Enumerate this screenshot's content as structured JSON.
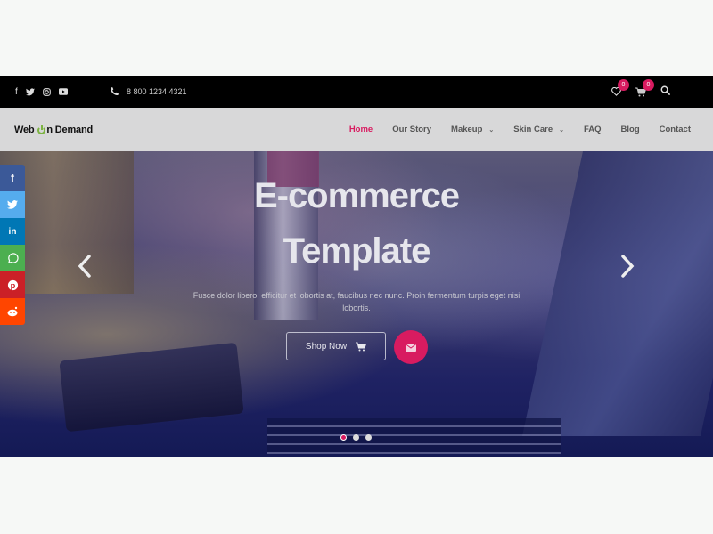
{
  "topbar": {
    "social_icons": [
      "facebook-icon",
      "twitter-icon",
      "instagram-icon",
      "youtube-icon"
    ],
    "phone": "8 800 1234 4321",
    "wishlist_count": "0",
    "cart_count": "0"
  },
  "navbar": {
    "logo_part1": "Web ",
    "logo_part2": "n Demand",
    "items": [
      {
        "label": "Home",
        "active": true
      },
      {
        "label": "Our Story"
      },
      {
        "label": "Makeup",
        "dropdown": true
      },
      {
        "label": "Skin Care",
        "dropdown": true
      },
      {
        "label": "FAQ"
      },
      {
        "label": "Blog"
      },
      {
        "label": "Contact"
      }
    ]
  },
  "hero": {
    "title_line1": "E-commerce",
    "title_line2": "Template",
    "subtitle": "Fusce dolor libero, efficitur et lobortis at, faucibus nec nunc. Proin fermentum turpis eget nisi lobortis.",
    "shop_button": "Shop Now",
    "slide_count": 3,
    "active_slide": 1
  },
  "share_bar": [
    "facebook",
    "twitter",
    "linkedin",
    "whatsapp",
    "pinterest",
    "reddit"
  ],
  "colors": {
    "accent": "#d81b60",
    "topbar_bg": "#000000",
    "navbar_bg": "#d8d8d9"
  }
}
